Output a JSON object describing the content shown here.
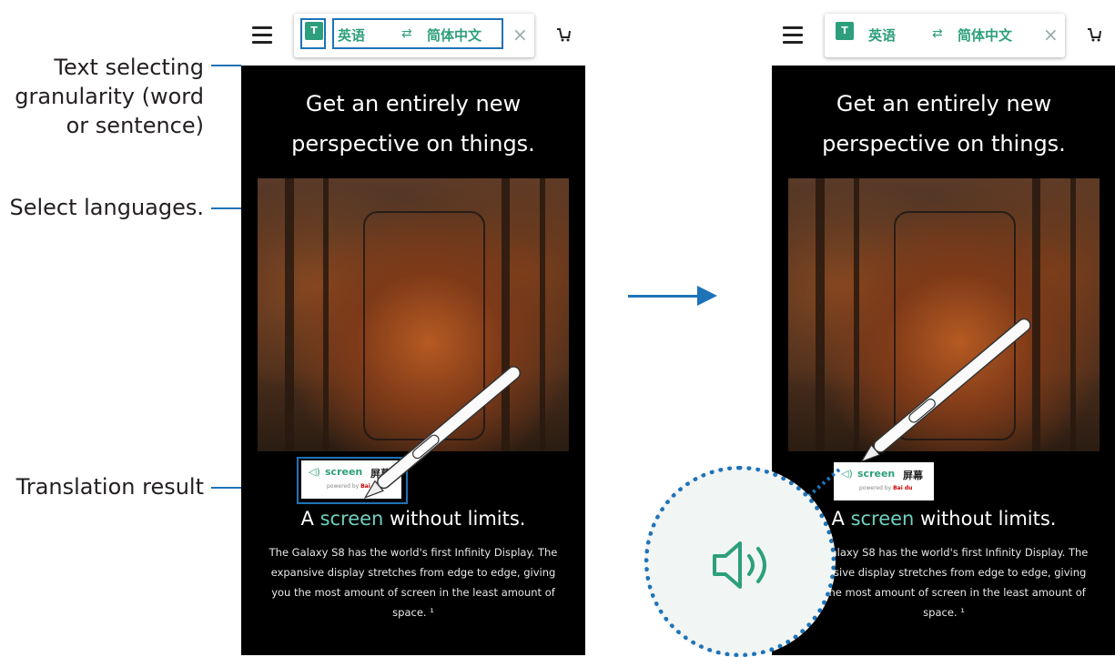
{
  "callouts": {
    "granularity": "Text selecting granularity (word or sentence)",
    "granularity_lines": [
      "Text selecting",
      "granularity (word",
      "or sentence)"
    ],
    "languages": "Select languages.",
    "result": "Translation result"
  },
  "translate_bar": {
    "granularity_icon": "T",
    "source_language": "英语",
    "swap_icon": "swap-arrows-icon",
    "target_language": "简体中文",
    "close_icon": "×"
  },
  "page": {
    "headline_lines": [
      "Get an entirely new",
      "perspective on things."
    ],
    "subhead_pre": "A ",
    "subhead_word": "screen",
    "subhead_post": " without limits.",
    "body_lines": [
      "The Galaxy S8 has the world's first Infinity Display. The",
      "expansive display stretches from edge to edge, giving",
      "you the most amount of screen in the least amount of",
      "space. ¹"
    ]
  },
  "tooltip": {
    "speaker_icon": "speaker-icon",
    "word": "screen",
    "result": "屏幕",
    "powered_by": "powered by",
    "provider": "Bai du"
  },
  "colors": {
    "accent": "#2d9f7c",
    "callout_blue": "#1e73b8",
    "highlight_word": "#6fd0c0"
  }
}
